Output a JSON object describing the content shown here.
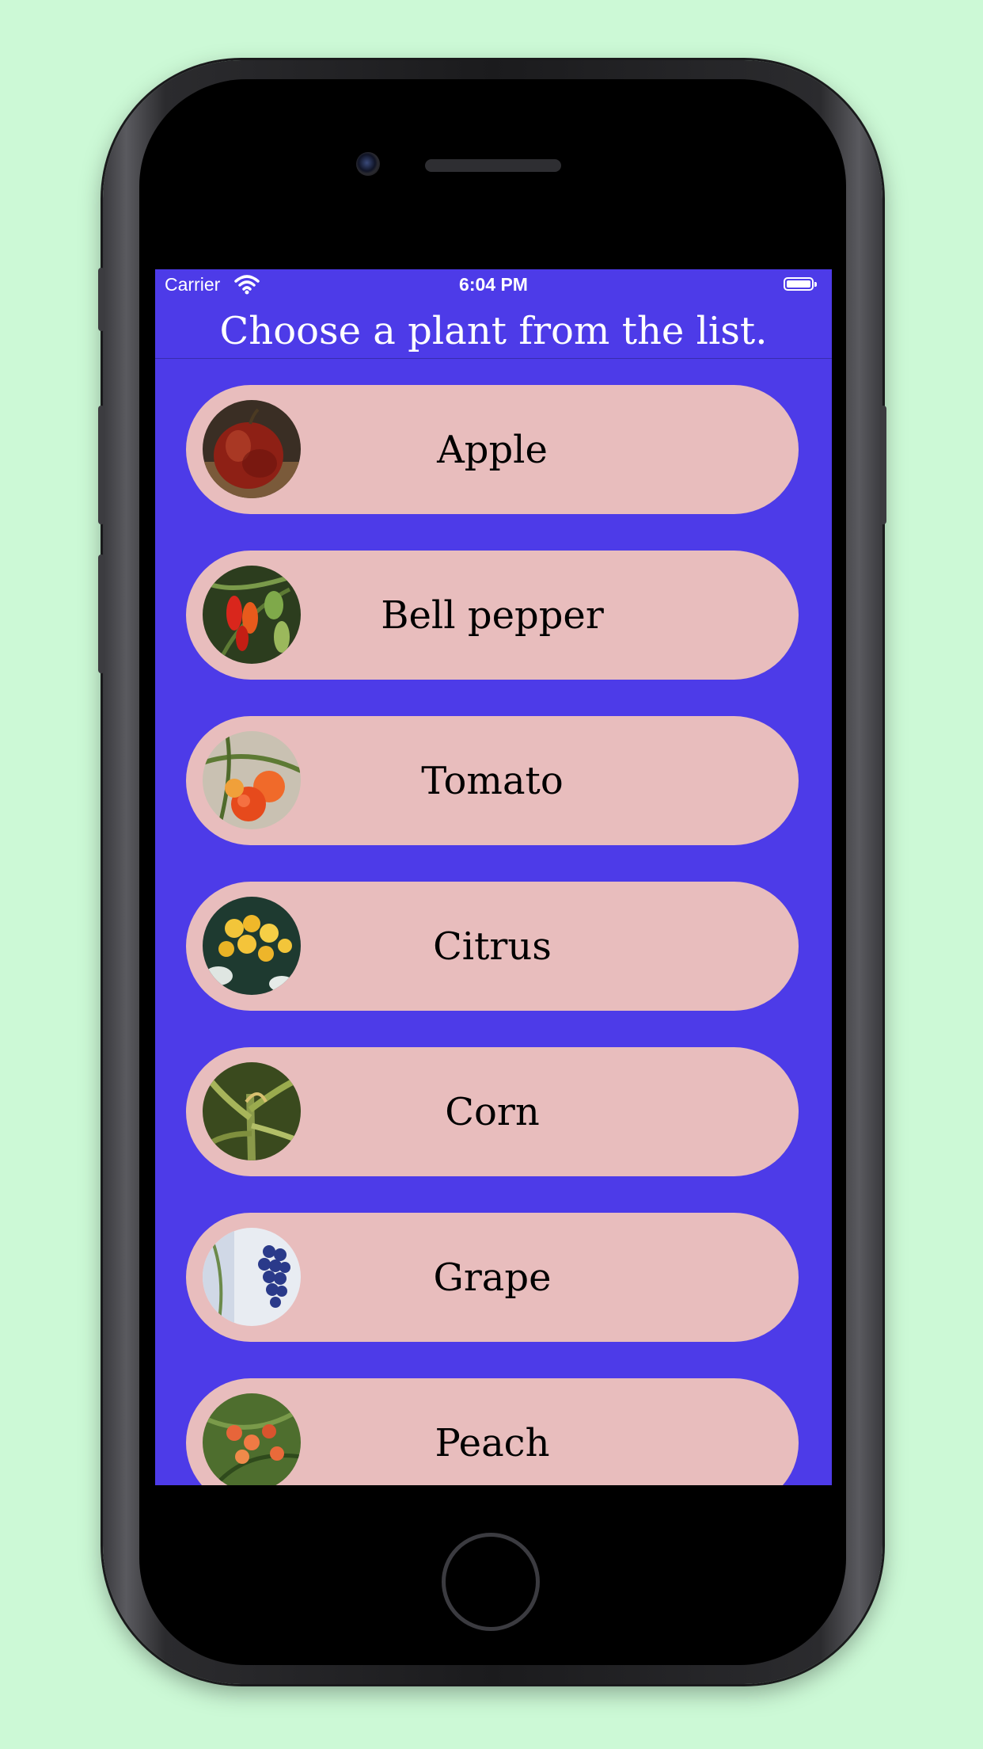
{
  "status_bar": {
    "carrier": "Carrier",
    "time": "6:04 PM"
  },
  "nav": {
    "title": "Choose a plant from the list."
  },
  "plants": [
    {
      "name": "Apple"
    },
    {
      "name": "Bell pepper"
    },
    {
      "name": "Tomato"
    },
    {
      "name": "Citrus"
    },
    {
      "name": "Corn"
    },
    {
      "name": "Grape"
    },
    {
      "name": "Peach"
    }
  ],
  "colors": {
    "background": "#ccf9d6",
    "screen": "#4d3be8",
    "row": "#e8bdbd",
    "title_text": "#ffffff"
  }
}
